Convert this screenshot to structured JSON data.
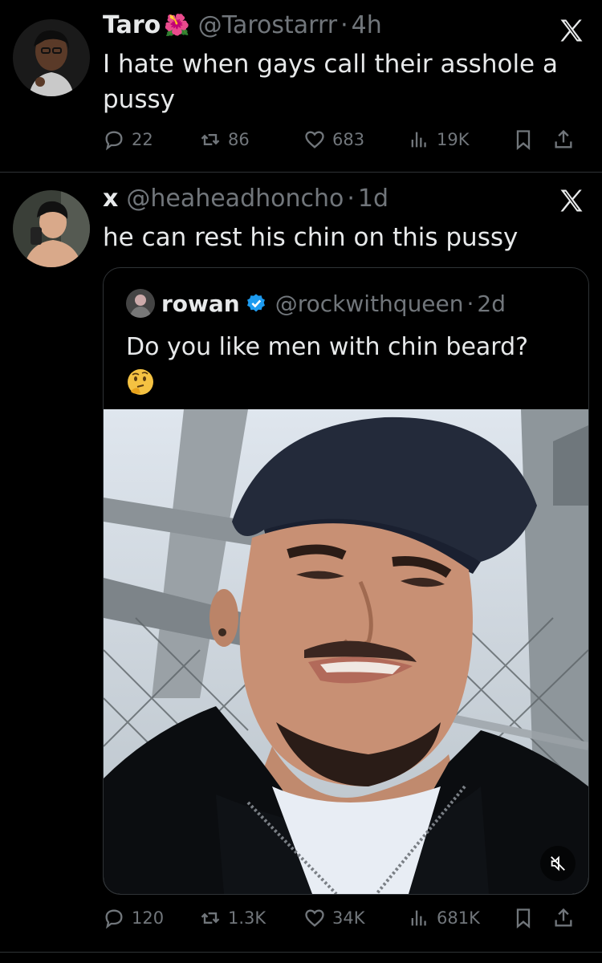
{
  "tweet1": {
    "display_name": "Taro",
    "flower": "🌺",
    "handle": "@Tarostarrr",
    "dot": "·",
    "time": "4h",
    "text": "I hate when gays call their asshole a pussy",
    "stats": {
      "replies": "22",
      "retweets": "86",
      "likes": "683",
      "views": "19K"
    }
  },
  "tweet2": {
    "display_name": "x",
    "handle": "@heaheadhoncho",
    "dot": "·",
    "time": "1d",
    "text": "he can rest his chin on this pussy",
    "stats": {
      "replies": "120",
      "retweets": "1.3K",
      "likes": "34K",
      "views": "681K"
    },
    "quote": {
      "display_name": "rowan",
      "handle": "@rockwithqueen",
      "dot": "·",
      "time": "2d",
      "text": "Do you like men with chin beard?",
      "emoji": "thinking-face"
    }
  },
  "colors": {
    "bg": "#000000",
    "text": "#e7e9ea",
    "muted": "#71767b",
    "verified": "#1d9bf0",
    "border": "#2f3336"
  }
}
